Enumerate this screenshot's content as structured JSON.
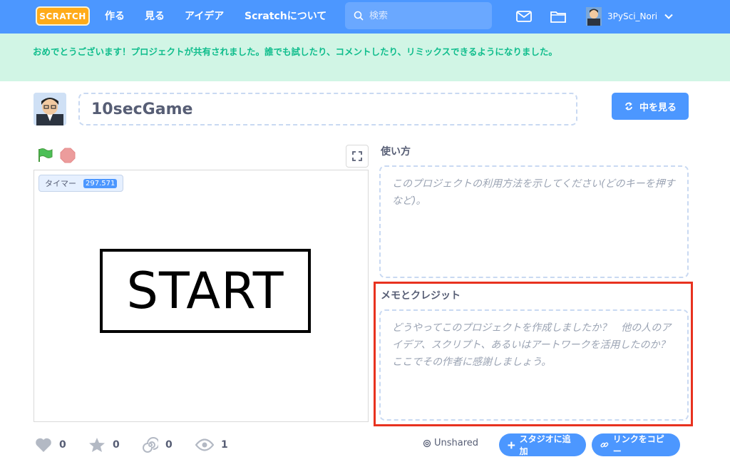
{
  "nav": {
    "logo": "SCRATCH",
    "links": [
      "作る",
      "見る",
      "アイデア",
      "Scratchについて"
    ],
    "search_placeholder": "検索",
    "username": "3PySci_Nori"
  },
  "banner": {
    "message": "おめでとうございます！プロジェクトが共有されました。誰でも試したり、コメントしたり、リミックスできるようになりました。"
  },
  "project": {
    "title": "10secGame",
    "see_inside_label": "中を見る"
  },
  "stage": {
    "monitor_label": "タイマー",
    "monitor_value": "297.571",
    "start_text": "START"
  },
  "instructions": {
    "label": "使い方",
    "placeholder": "このプロジェクトの利用方法を示してください(どのキーを押すなど)。"
  },
  "notes": {
    "label": "メモとクレジット",
    "placeholder": "どうやってこのプロジェクトを作成しましたか？　他の人のアイデア、スクリプト、あるいはアートワークを活用したのか？　ここでその作者に感謝しましょう。"
  },
  "stats": {
    "loves": "0",
    "favorites": "0",
    "remixes": "0",
    "views": "1"
  },
  "actions": {
    "unshared": "Unshared",
    "add_to_studio": "スタジオに追加",
    "copy_link": "リンクをコピー"
  },
  "colors": {
    "nav": "#4c97ff",
    "banner": "#d1f5e5",
    "banner_text": "#0fbd8c",
    "highlight": "#e8321f"
  }
}
